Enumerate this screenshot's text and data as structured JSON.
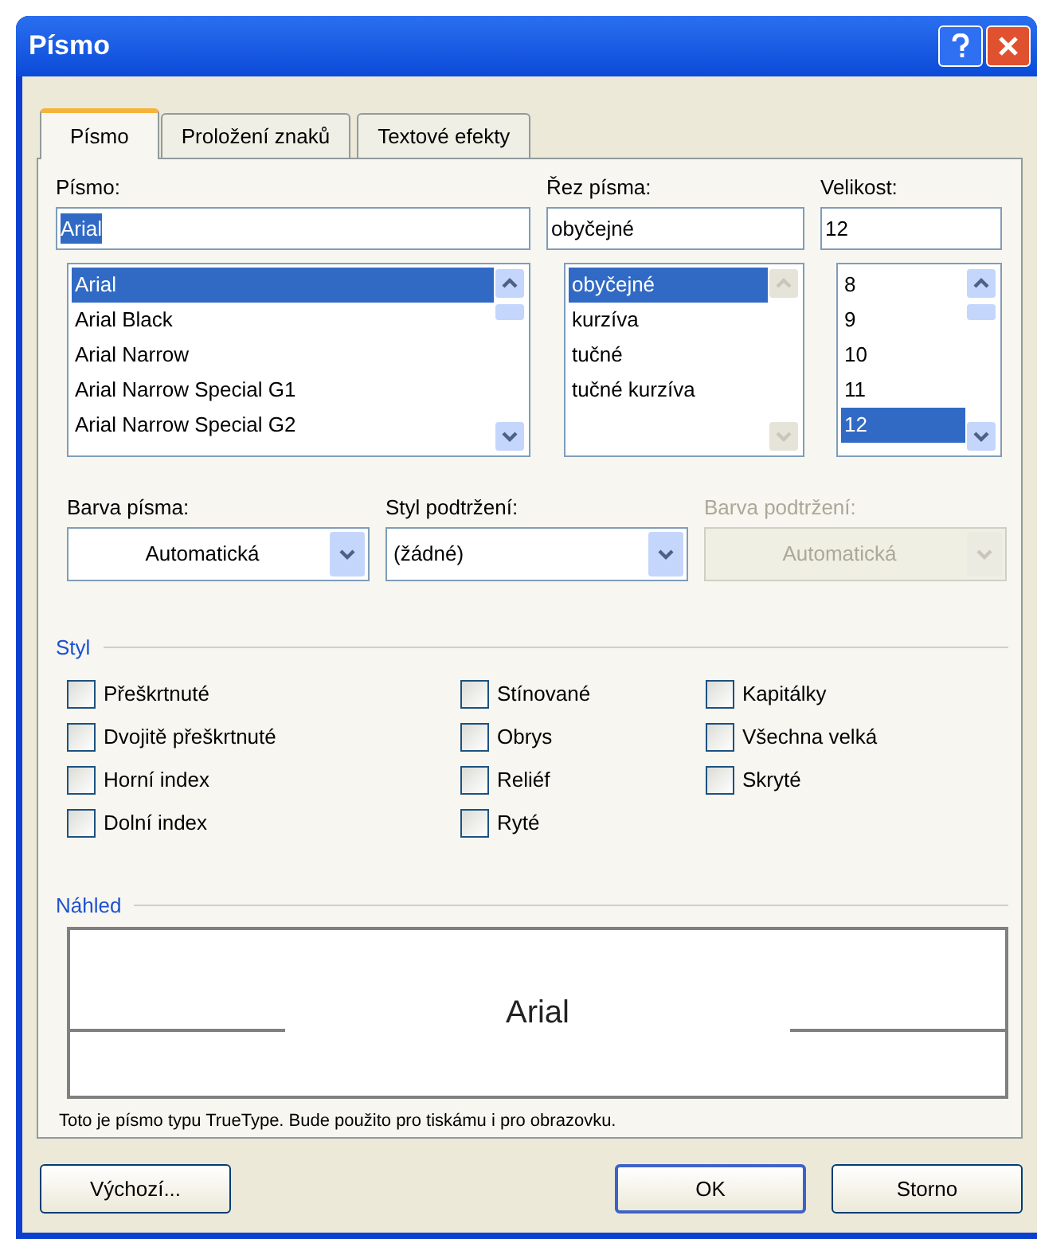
{
  "window": {
    "title": "Písmo"
  },
  "tabs": [
    {
      "label": "Písmo",
      "selected": true
    },
    {
      "label": "Proložení znaků",
      "selected": false
    },
    {
      "label": "Textové efekty",
      "selected": false
    }
  ],
  "font": {
    "label": "Písmo:",
    "value": "Arial",
    "items": [
      {
        "label": "Arial",
        "selected": true
      },
      {
        "label": "Arial Black",
        "selected": false
      },
      {
        "label": "Arial Narrow",
        "selected": false
      },
      {
        "label": "Arial Narrow Special G1",
        "selected": false
      },
      {
        "label": "Arial Narrow Special G2",
        "selected": false
      }
    ]
  },
  "style": {
    "label": "Řez písma:",
    "value": "obyčejné",
    "items": [
      {
        "label": "obyčejné",
        "selected": true
      },
      {
        "label": "kurzíva",
        "selected": false
      },
      {
        "label": "tučné",
        "selected": false
      },
      {
        "label": "tučné kurzíva",
        "selected": false
      }
    ]
  },
  "size": {
    "label": "Velikost:",
    "value": "12",
    "items": [
      {
        "label": "8",
        "selected": false
      },
      {
        "label": "9",
        "selected": false
      },
      {
        "label": "10",
        "selected": false
      },
      {
        "label": "11",
        "selected": false
      },
      {
        "label": "12",
        "selected": true
      }
    ]
  },
  "combos": [
    {
      "label": "Barva písma:",
      "value": "Automatická",
      "disabled": false,
      "centered": true
    },
    {
      "label": "Styl podtržení:",
      "value": "(žádné)",
      "disabled": false,
      "centered": false
    },
    {
      "label": "Barva podtržení:",
      "value": "Automatická",
      "disabled": true,
      "centered": true
    }
  ],
  "effects": {
    "title": "Styl",
    "columns": [
      [
        {
          "label": "Přeškrtnuté",
          "checked": false
        },
        {
          "label": "Dvojitě přeškrtnuté",
          "checked": false
        },
        {
          "label": "Horní index",
          "checked": false
        },
        {
          "label": "Dolní index",
          "checked": false
        }
      ],
      [
        {
          "label": "Stínované",
          "checked": false
        },
        {
          "label": "Obrys",
          "checked": false
        },
        {
          "label": "Reliéf",
          "checked": false
        },
        {
          "label": "Ryté",
          "checked": false
        }
      ],
      [
        {
          "label": "Kapitálky",
          "checked": false
        },
        {
          "label": "Všechna velká",
          "checked": false
        },
        {
          "label": "Skryté",
          "checked": false
        }
      ]
    ]
  },
  "preview": {
    "title": "Náhled",
    "sample": "Arial",
    "note": "Toto je písmo typu TrueType. Bude použito pro tiskámu i pro obrazovku."
  },
  "buttons": [
    {
      "label": "Výchozí...",
      "default": false
    },
    {
      "label": "OK",
      "default": true
    },
    {
      "label": "Storno",
      "default": false
    }
  ]
}
